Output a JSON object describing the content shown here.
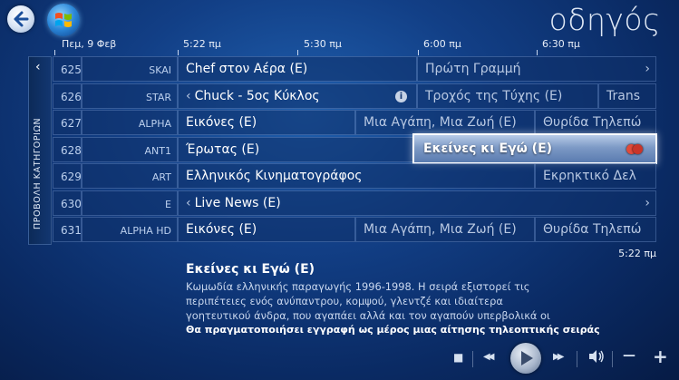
{
  "header": {
    "title": "οδηγός",
    "back_icon": "back-arrow-icon",
    "logo_icon": "windows-logo-icon"
  },
  "timeline": {
    "date": "Πεμ, 9 Φεβ",
    "times": [
      "5:22 πμ",
      "5:30 πμ",
      "6:00 πμ",
      "6:30 πμ"
    ]
  },
  "category": {
    "label": "ΠΡΟΒΟΛΗ ΚΑΤΗΓΟΡΙΩΝ",
    "chevron": "‹"
  },
  "channels": [
    {
      "number": "625",
      "name": "SKAI",
      "programs": [
        "Chef στον Αέρα (E)",
        "Πρώτη Γραμμή"
      ]
    },
    {
      "number": "626",
      "name": "STAR",
      "programs": [
        "Chuck - 5ος Κύκλος",
        "Τροχός της Τύχης (E)",
        "Trans"
      ]
    },
    {
      "number": "627",
      "name": "ALPHA",
      "programs": [
        "Εικόνες (E)",
        "Μια Αγάπη, Μια Ζωή (E)",
        "Θυρίδα Τηλεπώ"
      ]
    },
    {
      "number": "628",
      "name": "ANT1",
      "programs": [
        "Έρωτας (E)",
        "Εκείνες κι Εγώ (E)"
      ]
    },
    {
      "number": "629",
      "name": "ART",
      "programs": [
        "Ελληνικός Κινηματογράφος",
        "Εκρηκτικό Δελ"
      ]
    },
    {
      "number": "630",
      "name": "E",
      "programs": [
        "Live News (E)"
      ]
    },
    {
      "number": "631",
      "name": "ALPHA HD",
      "programs": [
        "Εικόνες (E)",
        "Μια Αγάπη, Μια Ζωή (E)",
        "Θυρίδα Τηλεπώ"
      ]
    }
  ],
  "details": {
    "clock": "5:22 πμ",
    "title": "Εκείνες κι Εγώ (E)",
    "description_lines": [
      "Κωμωδία ελληνικής παραγωγής 1996-1998. Η σειρά εξιστορεί τις",
      "περιπέτειες ενός ανύπαντρου, κομψού, γλεντζέ και ιδιαίτερα",
      "γοητευτικού άνδρα, που αγαπάει αλλά και τον αγαπούν υπερβολικά οι"
    ],
    "record_note": "Θα πραγματοποιήσει εγγραφή ως μέρος μιας αίτησης τηλεοπτικής σειράς"
  },
  "transport": {
    "stop": "■",
    "rewind": "◀◀",
    "forward": "▶▶",
    "volume_down": "—",
    "volume_up": "+"
  },
  "colors": {
    "focus_border": "#ffffff",
    "record_red": "#d9362b"
  }
}
